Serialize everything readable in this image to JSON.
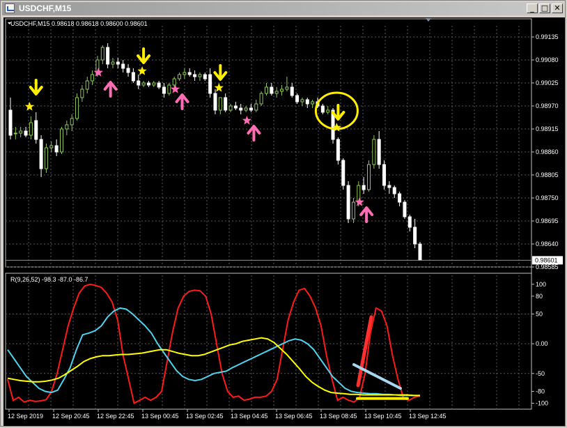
{
  "window": {
    "title": "USDCHF,M15",
    "buttons": {
      "minimize": "_",
      "maximize": "□",
      "close": "✕"
    }
  },
  "chart_data": [
    {
      "type": "candlestick",
      "header": "USDCHF,M15  0.98618 0.98618 0.98600 0.98601",
      "symbol": "USDCHF",
      "timeframe": "M15",
      "ohlc_header": [
        0.98618,
        0.98618,
        0.986,
        0.98601
      ],
      "price_ticks": [
        "0.99135",
        "0.99080",
        "0.99025",
        "0.98970",
        "0.98915",
        "0.98860",
        "0.98805",
        "0.98750",
        "0.98695",
        "0.98640",
        "0.98585"
      ],
      "current_price_label": "0.98601",
      "ylim": [
        0.98585,
        0.99155
      ],
      "x_ticks": [
        "12 Sep 2019",
        "12 Sep 20:45",
        "12 Sep 22:45",
        "13 Sep 00:45",
        "13 Sep 02:45",
        "13 Sep 04:45",
        "13 Sep 06:45",
        "13 Sep 08:45",
        "13 Sep 10:45",
        "13 Sep 12:45"
      ],
      "candles": [
        [
          0.9896,
          0.9899,
          0.9889,
          0.989
        ],
        [
          0.98905,
          0.9892,
          0.9889,
          0.98905
        ],
        [
          0.98905,
          0.9892,
          0.98895,
          0.9891
        ],
        [
          0.9891,
          0.9892,
          0.98895,
          0.989
        ],
        [
          0.989,
          0.98945,
          0.9889,
          0.9893
        ],
        [
          0.98935,
          0.98955,
          0.9888,
          0.9889
        ],
        [
          0.9889,
          0.989,
          0.988,
          0.9882
        ],
        [
          0.9882,
          0.9888,
          0.9881,
          0.9887
        ],
        [
          0.9887,
          0.98885,
          0.9886,
          0.98875
        ],
        [
          0.98875,
          0.9889,
          0.9885,
          0.9886
        ],
        [
          0.9886,
          0.9892,
          0.98855,
          0.98915
        ],
        [
          0.98915,
          0.98935,
          0.989,
          0.98925
        ],
        [
          0.98925,
          0.9895,
          0.9891,
          0.9894
        ],
        [
          0.9894,
          0.99,
          0.98935,
          0.9899
        ],
        [
          0.9899,
          0.9902,
          0.9898,
          0.9901
        ],
        [
          0.9901,
          0.9904,
          0.99,
          0.9903
        ],
        [
          0.9903,
          0.99055,
          0.9902,
          0.99045
        ],
        [
          0.99045,
          0.9909,
          0.9904,
          0.9908
        ],
        [
          0.9908,
          0.99115,
          0.9907,
          0.9911
        ],
        [
          0.9911,
          0.9912,
          0.9906,
          0.9907
        ],
        [
          0.9907,
          0.99085,
          0.9906,
          0.99075
        ],
        [
          0.99075,
          0.99085,
          0.9906,
          0.9907
        ],
        [
          0.9907,
          0.9908,
          0.9905,
          0.9906
        ],
        [
          0.9906,
          0.9907,
          0.9904,
          0.9905
        ],
        [
          0.9905,
          0.9906,
          0.99025,
          0.9903
        ],
        [
          0.9903,
          0.99045,
          0.9901,
          0.9902
        ],
        [
          0.9902,
          0.9903,
          0.99015,
          0.99025
        ],
        [
          0.99025,
          0.9903,
          0.99015,
          0.9902
        ],
        [
          0.9902,
          0.9903,
          0.99015,
          0.99025
        ],
        [
          0.99025,
          0.9903,
          0.9901,
          0.99015
        ],
        [
          0.99015,
          0.99025,
          0.9899,
          0.99
        ],
        [
          0.99,
          0.99025,
          0.98995,
          0.9902
        ],
        [
          0.9902,
          0.9904,
          0.99015,
          0.99035
        ],
        [
          0.99035,
          0.9905,
          0.9903,
          0.99045
        ],
        [
          0.99045,
          0.9906,
          0.99035,
          0.9905
        ],
        [
          0.9905,
          0.9906,
          0.9904,
          0.99045
        ],
        [
          0.99045,
          0.99055,
          0.9903,
          0.9904
        ],
        [
          0.9904,
          0.9905,
          0.9903,
          0.99045
        ],
        [
          0.99045,
          0.9905,
          0.9903,
          0.99035
        ],
        [
          0.99045,
          0.9906,
          0.9899,
          0.99
        ],
        [
          0.99,
          0.9901,
          0.9895,
          0.9896
        ],
        [
          0.9896,
          0.9899,
          0.9895,
          0.9899
        ],
        [
          0.9899,
          0.99,
          0.98955,
          0.9896
        ],
        [
          0.9896,
          0.98975,
          0.98955,
          0.9897
        ],
        [
          0.9897,
          0.9898,
          0.9896,
          0.98965
        ],
        [
          0.98965,
          0.98975,
          0.9895,
          0.9896
        ],
        [
          0.9896,
          0.9897,
          0.98955,
          0.98965
        ],
        [
          0.98965,
          0.98975,
          0.98955,
          0.9896
        ],
        [
          0.9896,
          0.98985,
          0.98955,
          0.98975
        ],
        [
          0.98975,
          0.99005,
          0.9897,
          0.99
        ],
        [
          0.99,
          0.99025,
          0.98995,
          0.99015
        ],
        [
          0.99015,
          0.99025,
          0.98995,
          0.99
        ],
        [
          0.99,
          0.99015,
          0.9899,
          0.99005
        ],
        [
          0.99005,
          0.9902,
          0.98995,
          0.9901
        ],
        [
          0.9901,
          0.9904,
          0.99005,
          0.99015
        ],
        [
          0.99015,
          0.99025,
          0.9899,
          0.98995
        ],
        [
          0.98995,
          0.99,
          0.98975,
          0.9898
        ],
        [
          0.9898,
          0.9899,
          0.9897,
          0.98985
        ],
        [
          0.98985,
          0.9899,
          0.98965,
          0.98975
        ],
        [
          0.98975,
          0.98985,
          0.98965,
          0.9898
        ],
        [
          0.9898,
          0.9899,
          0.98965,
          0.9897
        ],
        [
          0.9897,
          0.98975,
          0.9895,
          0.98955
        ],
        [
          0.98955,
          0.9897,
          0.9895,
          0.9896
        ],
        [
          0.9896,
          0.98965,
          0.9888,
          0.9889
        ],
        [
          0.9889,
          0.98895,
          0.9883,
          0.9884
        ],
        [
          0.9884,
          0.98845,
          0.9877,
          0.9878
        ],
        [
          0.9878,
          0.9879,
          0.9869,
          0.987
        ],
        [
          0.987,
          0.9875,
          0.9869,
          0.9874
        ],
        [
          0.9874,
          0.9879,
          0.9873,
          0.9878
        ],
        [
          0.9878,
          0.988,
          0.9876,
          0.9877
        ],
        [
          0.9877,
          0.9884,
          0.98765,
          0.9883
        ],
        [
          0.9883,
          0.989,
          0.9882,
          0.9889
        ],
        [
          0.9889,
          0.9891,
          0.9882,
          0.9883
        ],
        [
          0.9883,
          0.9884,
          0.9877,
          0.9878
        ],
        [
          0.9878,
          0.9879,
          0.9876,
          0.98775
        ],
        [
          0.98775,
          0.9878,
          0.9875,
          0.9876
        ],
        [
          0.9876,
          0.98765,
          0.9873,
          0.9874
        ],
        [
          0.9874,
          0.98745,
          0.987,
          0.98705
        ],
        [
          0.98705,
          0.9871,
          0.9867,
          0.9868
        ],
        [
          0.9868,
          0.987,
          0.9863,
          0.9864
        ],
        [
          0.9864,
          0.98645,
          0.986,
          0.98601
        ]
      ],
      "signals": {
        "yellow_down_arrow_candles": [
          5,
          26,
          41,
          64
        ],
        "yellow_star_candles": [
          4,
          26,
          41,
          64
        ],
        "pink_up_arrow_candles": [
          19,
          33,
          47,
          69
        ],
        "pink_star_candles": [
          18,
          33,
          47,
          69
        ],
        "circled_candle": 64
      }
    },
    {
      "type": "line",
      "header": "R(9,26,52) -98.3 -87.0 -86.7",
      "indicator": "R(9,26,52)",
      "header_values": [
        -98.3,
        -87.0,
        -86.7
      ],
      "y_ticks": [
        "100",
        "80",
        "50",
        "0.00",
        "-50",
        "-80",
        "-100"
      ],
      "ylim": [
        -110,
        115
      ],
      "series": [
        {
          "color": "#ff1a1a",
          "values": [
            -60,
            -95,
            -90,
            -98,
            -95,
            -97,
            -96,
            -94,
            -80,
            -50,
            -10,
            30,
            60,
            85,
            97,
            100,
            98,
            95,
            85,
            70,
            40,
            -20,
            -60,
            -100,
            -95,
            -90,
            -95,
            -90,
            -80,
            -30,
            20,
            60,
            80,
            88,
            90,
            89,
            80,
            50,
            0,
            -50,
            -80,
            -90,
            -88,
            -95,
            -93,
            -90,
            -90,
            -88,
            -80,
            -60,
            -10,
            40,
            70,
            90,
            93,
            80,
            60,
            30,
            -20,
            -60,
            -95,
            -90,
            -95,
            -98,
            -90,
            -50,
            20,
            60,
            55,
            30,
            -20,
            -60,
            -92,
            -95,
            -90,
            -88
          ]
        },
        {
          "color": "#4fd4f0",
          "values": [
            -10,
            -25,
            -40,
            -55,
            -65,
            -75,
            -80,
            -82,
            -78,
            -60,
            -40,
            -10,
            15,
            18,
            22,
            30,
            45,
            55,
            60,
            58,
            50,
            40,
            30,
            18,
            0,
            -15,
            -30,
            -45,
            -55,
            -60,
            -62,
            -60,
            -55,
            -50,
            -48,
            -46,
            -40,
            -35,
            -30,
            -25,
            -20,
            -15,
            -10,
            -5,
            0,
            5,
            8,
            6,
            0,
            -10,
            -25,
            -40,
            -55,
            -65,
            -75,
            -80,
            -82,
            -83,
            -84,
            -84,
            -85,
            -85,
            -86,
            -87,
            -87,
            -87,
            -87
          ]
        },
        {
          "color": "#ffff00",
          "values": [
            -58,
            -60,
            -62,
            -63,
            -64,
            -64,
            -63,
            -61,
            -58,
            -52,
            -45,
            -38,
            -30,
            -25,
            -22,
            -20,
            -20,
            -19,
            -18,
            -18,
            -17,
            -16,
            -14,
            -12,
            -10,
            -10,
            -13,
            -16,
            -18,
            -20,
            -20,
            -18,
            -14,
            -10,
            -6,
            -2,
            0,
            4,
            6,
            8,
            10,
            8,
            2,
            -8,
            -18,
            -30,
            -42,
            -55,
            -65,
            -72,
            -78,
            -82,
            -83,
            -84,
            -85,
            -85,
            -86,
            -86,
            -86,
            -86,
            -86,
            -86,
            -86,
            -86,
            -87,
            -87
          ]
        }
      ],
      "annotations": {
        "red_up_stroke": "sharp rise",
        "white_blue_down_stroke": "declining line",
        "yellow_flat_stroke": "flat line near -86"
      }
    }
  ]
}
